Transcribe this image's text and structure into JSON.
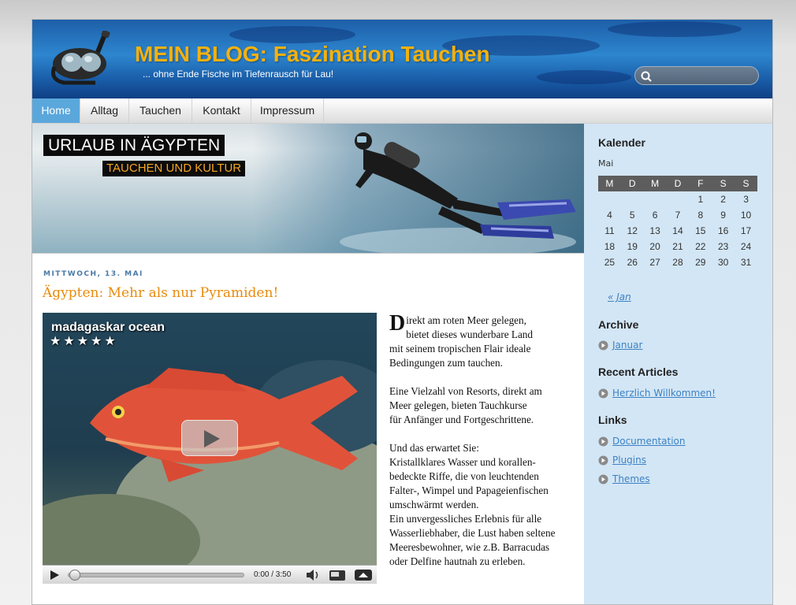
{
  "header": {
    "title": "MEIN BLOG: Faszination Tauchen",
    "tagline": "... ohne Ende Fische im Tiefenrausch für Lau!",
    "search_placeholder": ""
  },
  "nav": {
    "items": [
      {
        "label": "Home",
        "active": true
      },
      {
        "label": "Alltag"
      },
      {
        "label": "Tauchen"
      },
      {
        "label": "Kontakt"
      },
      {
        "label": "Impressum"
      }
    ]
  },
  "banner": {
    "title": "URLAUB IN ÄGYPTEN",
    "subtitle": "TAUCHEN UND KULTUR"
  },
  "post": {
    "date": "MITTWOCH, 13. MAI",
    "title": "Ägypten: Mehr als nur Pyramiden!",
    "dropcap": "D",
    "paragraph1": "irekt am roten Meer gelegen,\nbietet dieses wunderbare Land\nmit seinem tropischen Flair ideale\nBedingungen zum tauchen.",
    "paragraph2": "Eine Vielzahl von Resorts, direkt am\nMeer gelegen, bieten Tauchkurse\nfür Anfänger und Fortgeschrittene.",
    "paragraph3": "Und das erwartet Sie:\nKristallklares Wasser und korallen-\nbedeckte Riffe, die von leuchtenden\nFalter-, Wimpel und Papageienfischen\numschwärmt werden.\nEin unvergessliches Erlebnis für alle\nWasserliebhaber, die Lust haben seltene\nMeeresbewohner, wie z.B. Barracudas\noder Delfine hautnah zu erleben."
  },
  "video": {
    "caption": "madagaskar ocean",
    "stars": "★★★★★",
    "time": "0:00 / 3:50",
    "progress": 0
  },
  "sidebar": {
    "calendar": {
      "heading": "Kalender",
      "month": "Mai",
      "weekdays": [
        "M",
        "D",
        "M",
        "D",
        "F",
        "S",
        "S"
      ],
      "weeks": [
        [
          "",
          "",
          "",
          "",
          "1",
          "2",
          "3"
        ],
        [
          "4",
          "5",
          "6",
          "7",
          "8",
          "9",
          "10"
        ],
        [
          "11",
          "12",
          "13",
          "14",
          "15",
          "16",
          "17"
        ],
        [
          "18",
          "19",
          "20",
          "21",
          "22",
          "23",
          "24"
        ],
        [
          "25",
          "26",
          "27",
          "28",
          "29",
          "30",
          "31"
        ]
      ],
      "prev_link": "« Jan"
    },
    "archive": {
      "heading": "Archive",
      "items": [
        "Januar"
      ]
    },
    "recent": {
      "heading": "Recent Articles",
      "items": [
        "Herzlich Willkommen!"
      ]
    },
    "links": {
      "heading": "Links",
      "items": [
        "Documentation",
        "Plugins",
        "Themes"
      ]
    }
  },
  "colors": {
    "accent_orange": "#e88b0c",
    "title_gold": "#f7b10c",
    "nav_active": "#5aa7dc",
    "sidebar_bg": "#d3e6f5",
    "link_blue": "#3c82c4"
  }
}
